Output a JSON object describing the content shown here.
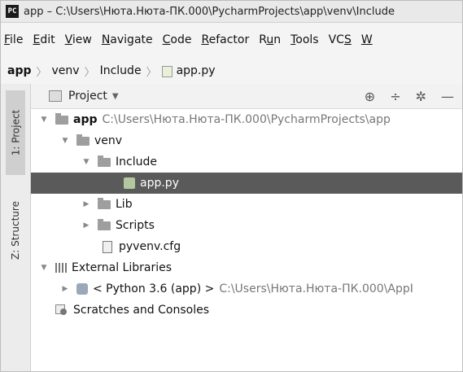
{
  "titlebar": {
    "app_icon": "PC",
    "title": "app – C:\\Users\\Нюта.Нюта-ПК.000\\PycharmProjects\\app\\venv\\Include"
  },
  "menubar": [
    {
      "label": "File",
      "u": "F",
      "rest": "ile"
    },
    {
      "label": "Edit",
      "u": "E",
      "rest": "dit"
    },
    {
      "label": "View",
      "u": "V",
      "rest": "iew"
    },
    {
      "label": "Navigate",
      "u": "N",
      "rest": "avigate"
    },
    {
      "label": "Code",
      "u": "C",
      "rest": "ode"
    },
    {
      "label": "Refactor",
      "u": "R",
      "rest": "efactor"
    },
    {
      "label": "Run",
      "pre": "R",
      "u": "u",
      "rest": "n"
    },
    {
      "label": "Tools",
      "u": "T",
      "rest": "ools"
    },
    {
      "label": "VCS",
      "pre": "VC",
      "u": "S",
      "rest": ""
    },
    {
      "label": "W",
      "u": "W",
      "rest": ""
    }
  ],
  "breadcrumb": [
    "app",
    "venv",
    "Include",
    "app.py"
  ],
  "sidestrip": {
    "project_tab": "1: Project",
    "structure_tab": "Z: Structure"
  },
  "panel": {
    "title": "Project",
    "tools": [
      "target-icon",
      "collapse-icon",
      "gear-icon",
      "minimize-icon"
    ]
  },
  "tree": {
    "app": {
      "label": "app",
      "path": "C:\\Users\\Нюта.Нюта-ПК.000\\PycharmProjects\\app"
    },
    "venv": "venv",
    "include": "Include",
    "apppy": "app.py",
    "lib": "Lib",
    "scripts": "Scripts",
    "pyvenv": "pyvenv.cfg",
    "external": "External Libraries",
    "python": {
      "label": "< Python 3.6 (app) >",
      "path": "C:\\Users\\Нюта.Нюта-ПК.000\\AppI"
    },
    "scratches": "Scratches and Consoles"
  }
}
